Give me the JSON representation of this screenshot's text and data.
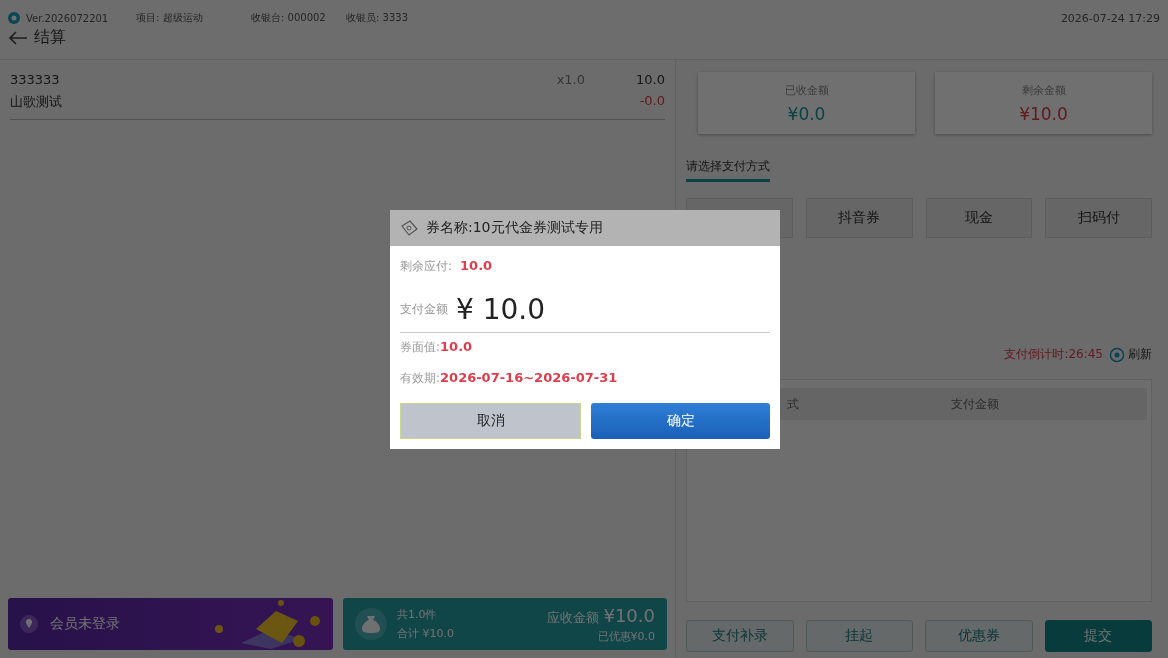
{
  "header": {
    "version": "Ver.2026072201",
    "project": "项目: 超级运动",
    "register": "收银台: 000002",
    "cashier": "收银员: 3333",
    "datetime": "2026-07-24 17:29",
    "title": "结算"
  },
  "order_items": [
    {
      "code": "333333",
      "quantity": "x1.0",
      "price": "10.0",
      "name": "山歌测试",
      "discount": "-0.0"
    }
  ],
  "member_card": {
    "label": "会员未登录"
  },
  "summary_card": {
    "count": "共1.0件",
    "total": "合计 ¥10.0",
    "due_label": "应收金额",
    "due": "¥10.0",
    "discounted": "已优惠¥0.0"
  },
  "stats": [
    {
      "label": "已收金额",
      "value": "¥0.0",
      "kind": "received"
    },
    {
      "label": "剩余金额",
      "value": "¥10.0",
      "kind": "remaining"
    }
  ],
  "payment_tab": {
    "label": "请选择支付方式",
    "selected": true
  },
  "payment_methods": [
    {
      "kind": "blank"
    },
    {
      "kind": "labeled",
      "label": "抖音券"
    },
    {
      "kind": "labeled",
      "label": "现金"
    },
    {
      "kind": "labeled",
      "label": "扫码付"
    }
  ],
  "countdown": "支付倒计时:26:45",
  "refresh": "刷新",
  "payments_table": {
    "columns": [
      "式",
      "支付金额"
    ]
  },
  "actions": [
    {
      "label": "支付补录",
      "primary": false
    },
    {
      "label": "挂起",
      "primary": false
    },
    {
      "label": "优惠券",
      "primary": false
    },
    {
      "label": "提交",
      "primary": true
    }
  ],
  "dialog": {
    "title": "券名称:10元代金券测试专用",
    "remaining_label": "剩余应付:",
    "remaining": "10.0",
    "amount_label": "支付金额",
    "amount": "¥ 10.0",
    "face_label": "券面值:",
    "face_value": "10.0",
    "validity_label": "有效期:",
    "validity": "2026-07-16~2026-07-31",
    "cancel": "取消",
    "confirm": "确定"
  }
}
